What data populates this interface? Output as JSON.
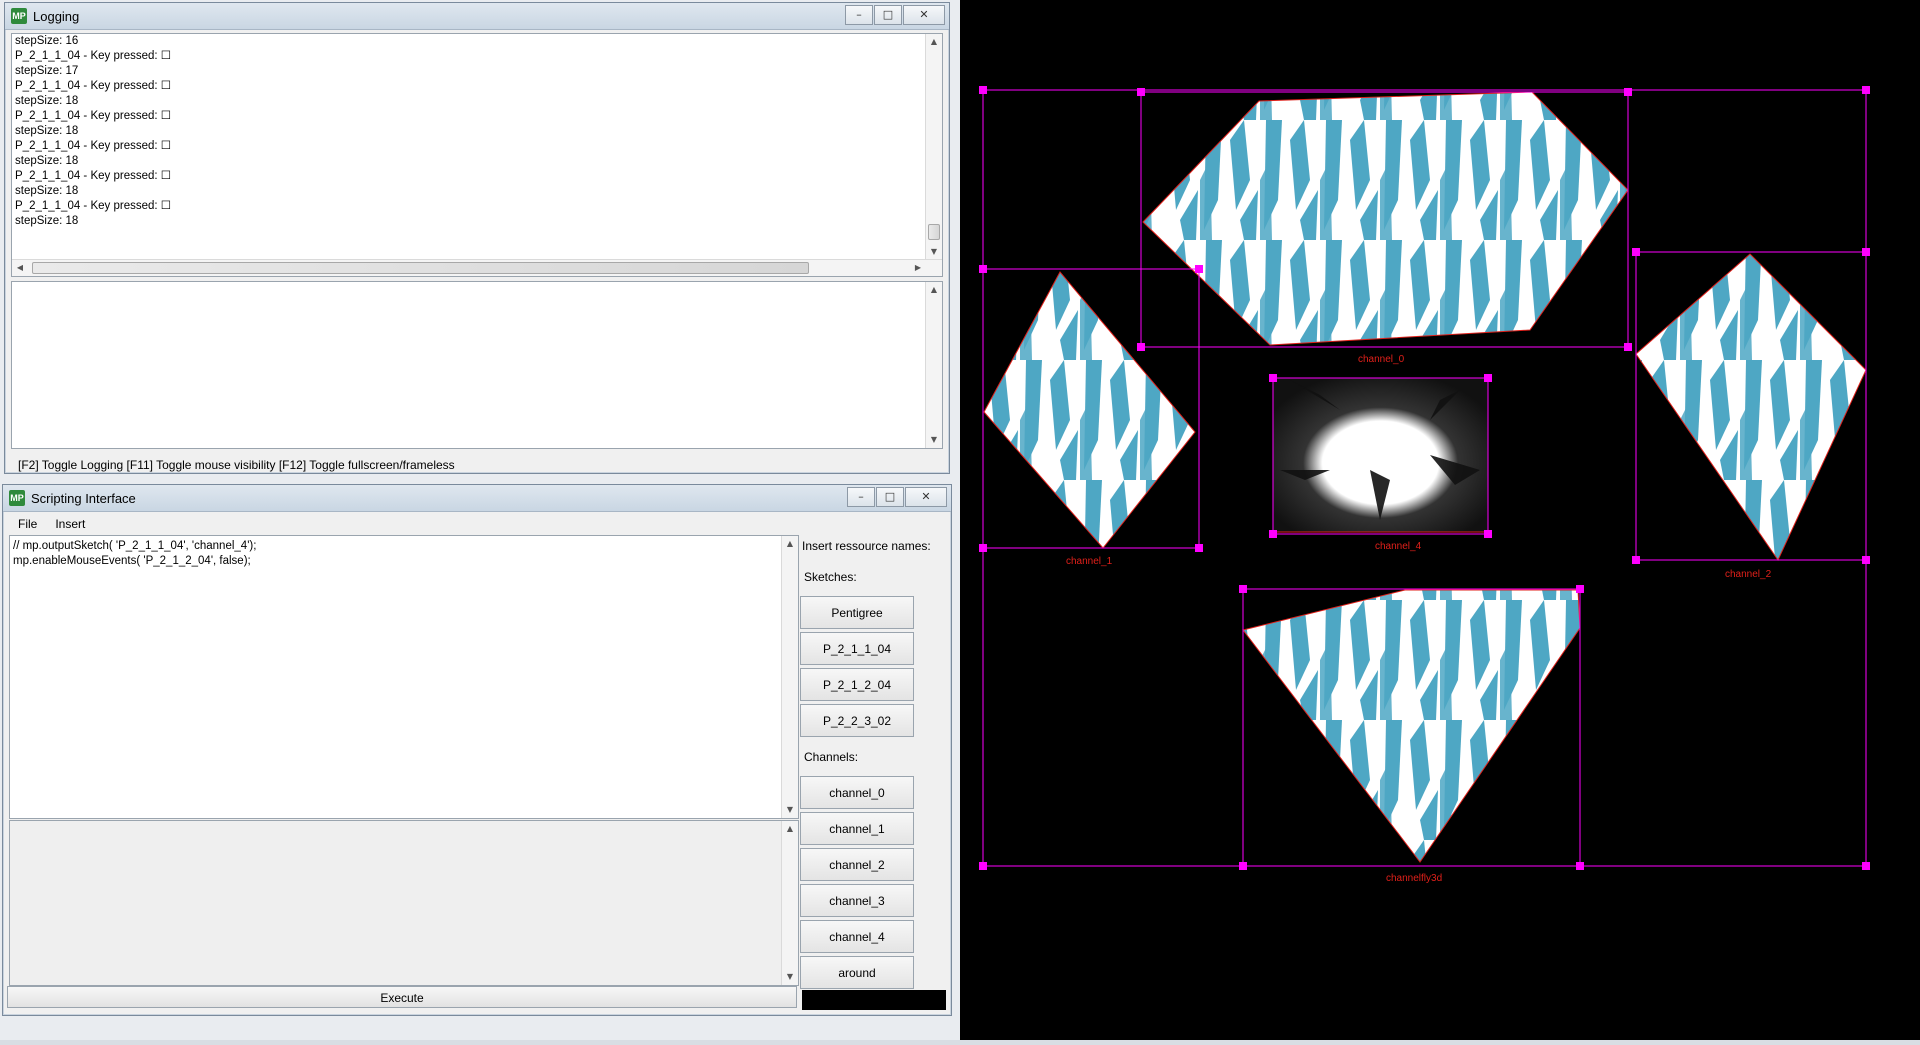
{
  "logging_window": {
    "title": "Logging",
    "icon_text": "MP",
    "log_lines": [
      "stepSize: 16",
      "P_2_1_1_04 - Key pressed: ☐",
      "stepSize: 17",
      "P_2_1_1_04 - Key pressed: ☐",
      "stepSize: 18",
      "P_2_1_1_04 - Key pressed: ☐",
      "stepSize: 18",
      "P_2_1_1_04 - Key pressed: ☐",
      "stepSize: 18",
      "P_2_1_1_04 - Key pressed: ☐",
      "stepSize: 18",
      "P_2_1_1_04 - Key pressed: ☐",
      "stepSize: 18"
    ],
    "status": "[F2] Toggle Logging [F11] Toggle mouse visibility [F12] Toggle fullscreen/frameless"
  },
  "scripting_window": {
    "title": "Scripting Interface",
    "icon_text": "MP",
    "menus": [
      "File",
      "Insert"
    ],
    "code_lines": [
      "// mp.outputSketch( 'P_2_1_1_04', 'channel_4');",
      "mp.enableMouseEvents( 'P_2_1_2_04', false);"
    ],
    "execute_label": "Execute",
    "resources_header": "Insert ressource names:",
    "sketches_label": "Sketches:",
    "sketches": [
      "Pentigree",
      "P_2_1_1_04",
      "P_2_1_2_04",
      "P_2_2_3_02"
    ],
    "channels_label": "Channels:",
    "channels": [
      "channel_0",
      "channel_1",
      "channel_2",
      "channel_3",
      "channel_4",
      "around"
    ]
  },
  "canvas": {
    "background": "#000000",
    "handle_color": "#ff00ff",
    "label_color": "#e0201a",
    "pattern_color": "#4ea7c4",
    "channel_labels": [
      "channel_0",
      "channel_1",
      "channel_2",
      "channel_4",
      "channelfly3d"
    ]
  },
  "icons": {
    "minimize": "minimize-icon",
    "maximize": "maximize-icon",
    "close": "close-icon"
  }
}
